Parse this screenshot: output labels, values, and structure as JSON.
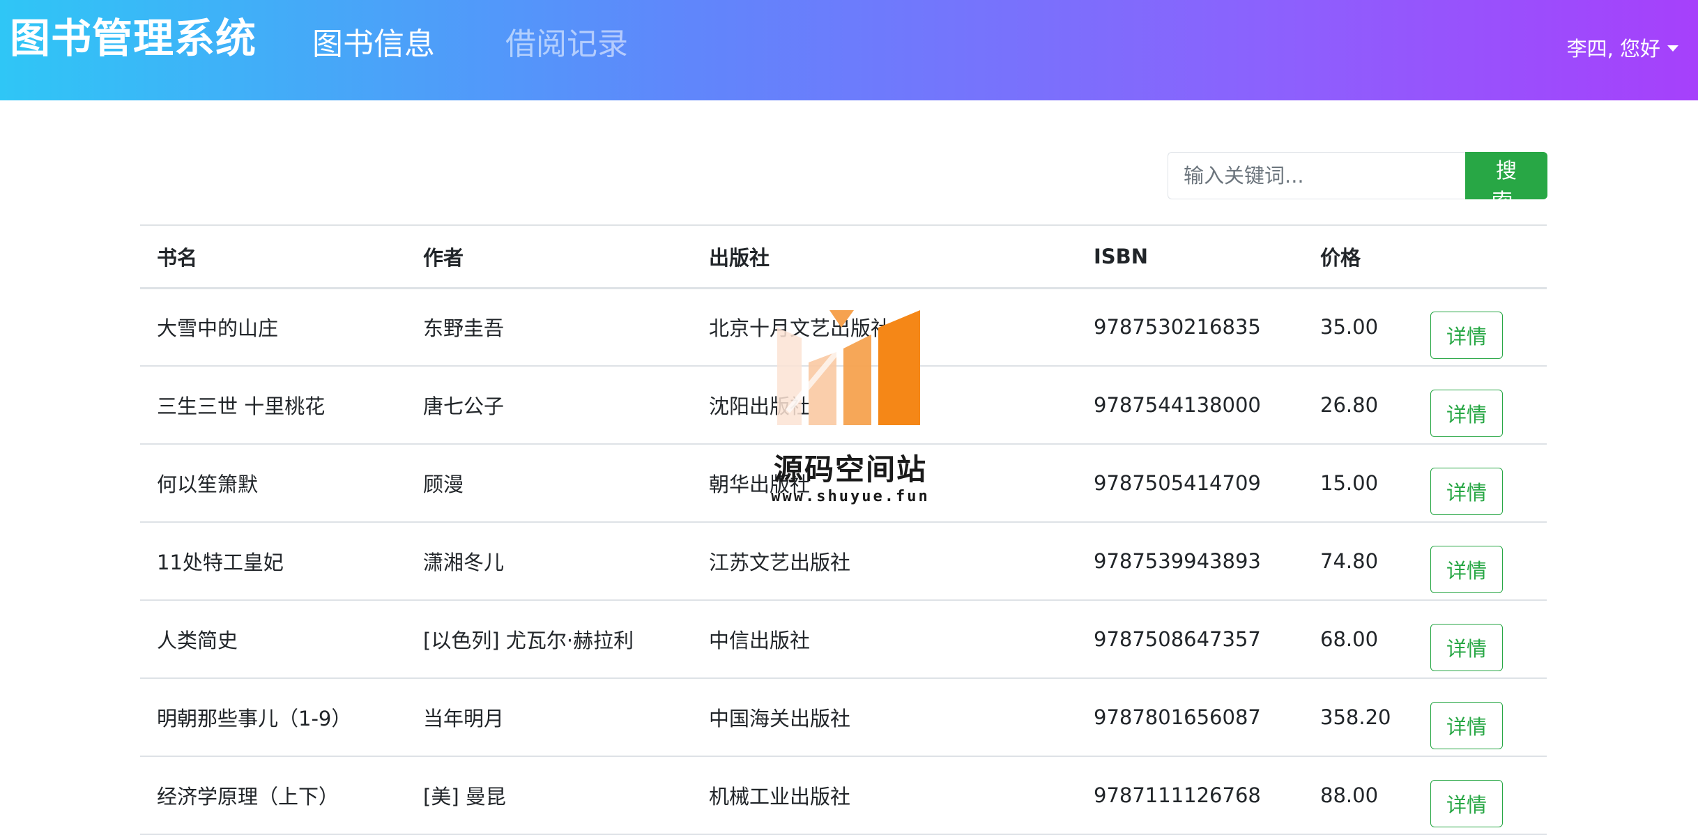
{
  "header": {
    "brand": "图书管理系统",
    "nav": [
      {
        "label": "图书信息",
        "active": true
      },
      {
        "label": "借阅记录",
        "active": false
      }
    ],
    "user_greeting": "李四, 您好"
  },
  "search": {
    "placeholder": "输入关键词...",
    "button_label": "搜 索"
  },
  "table": {
    "columns": [
      "书名",
      "作者",
      "出版社",
      "ISBN",
      "价格",
      ""
    ],
    "rows": [
      {
        "title": "大雪中的山庄",
        "author": "东野圭吾",
        "publisher": "北京十月文艺出版社",
        "isbn": "9787530216835",
        "price": "35.00",
        "action": "详情"
      },
      {
        "title": "三生三世 十里桃花",
        "author": "唐七公子",
        "publisher": "沈阳出版社",
        "isbn": "9787544138000",
        "price": "26.80",
        "action": "详情"
      },
      {
        "title": "何以笙箫默",
        "author": "顾漫",
        "publisher": "朝华出版社",
        "isbn": "9787505414709",
        "price": "15.00",
        "action": "详情"
      },
      {
        "title": "11处特工皇妃",
        "author": "潇湘冬儿",
        "publisher": "江苏文艺出版社",
        "isbn": "9787539943893",
        "price": "74.80",
        "action": "详情"
      },
      {
        "title": "人类简史",
        "author": "[以色列] 尤瓦尔·赫拉利",
        "publisher": "中信出版社",
        "isbn": "9787508647357",
        "price": "68.00",
        "action": "详情"
      },
      {
        "title": "明朝那些事儿（1-9）",
        "author": "当年明月",
        "publisher": "中国海关出版社",
        "isbn": "9787801656087",
        "price": "358.20",
        "action": "详情"
      },
      {
        "title": "经济学原理（上下）",
        "author": "[美] 曼昆",
        "publisher": "机械工业出版社",
        "isbn": "9787111126768",
        "price": "88.00",
        "action": "详情"
      }
    ]
  },
  "watermark": {
    "title": "源码空间站",
    "url": "www.shuyue.fun"
  },
  "colors": {
    "header_gradient_start": "#2fc6f6",
    "header_gradient_end": "#a640fb",
    "accent_green": "#28a745"
  }
}
